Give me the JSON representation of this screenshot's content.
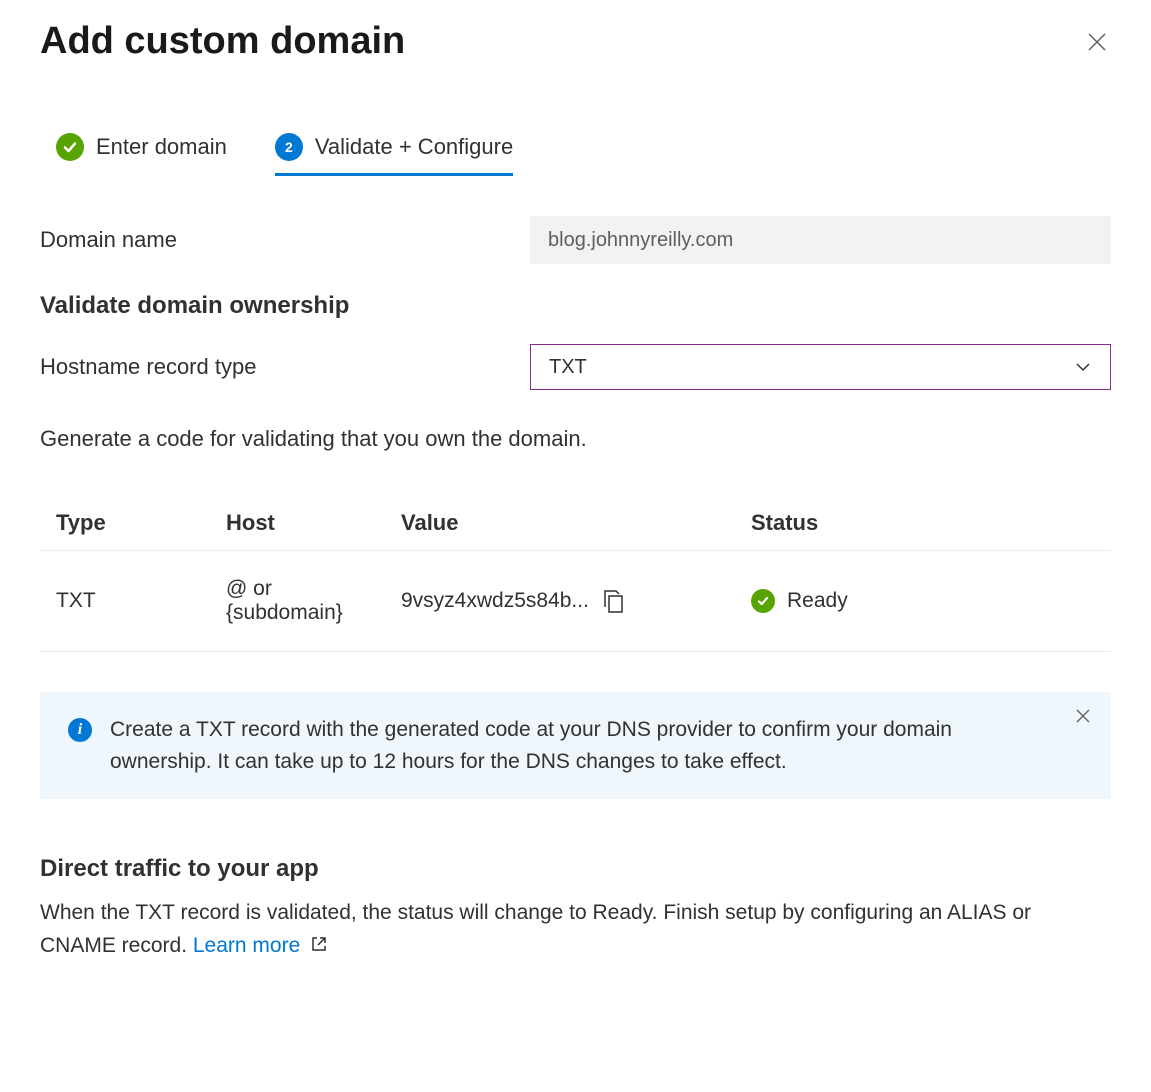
{
  "header": {
    "title": "Add custom domain"
  },
  "tabs": {
    "step1_label": "Enter domain",
    "step2_number": "2",
    "step2_label": "Validate + Configure"
  },
  "form": {
    "domain_name_label": "Domain name",
    "domain_name_value": "blog.johnnyreilly.com",
    "validate_section_title": "Validate domain ownership",
    "hostname_record_type_label": "Hostname record type",
    "hostname_record_type_value": "TXT",
    "help_text": "Generate a code for validating that you own the domain."
  },
  "table": {
    "headers": {
      "type": "Type",
      "host": "Host",
      "value": "Value",
      "status": "Status"
    },
    "row": {
      "type": "TXT",
      "host": "@ or {subdomain}",
      "value": "9vsyz4xwdz5s84b...",
      "status": "Ready"
    }
  },
  "info": {
    "text": "Create a TXT record with the generated code at your DNS provider to confirm your domain ownership. It can take up to 12 hours for the DNS changes to take effect."
  },
  "direct": {
    "title": "Direct traffic to your app",
    "text": "When the TXT record is validated, the status will change to Ready. Finish setup by configuring an ALIAS or CNAME record. ",
    "link": "Learn more"
  }
}
